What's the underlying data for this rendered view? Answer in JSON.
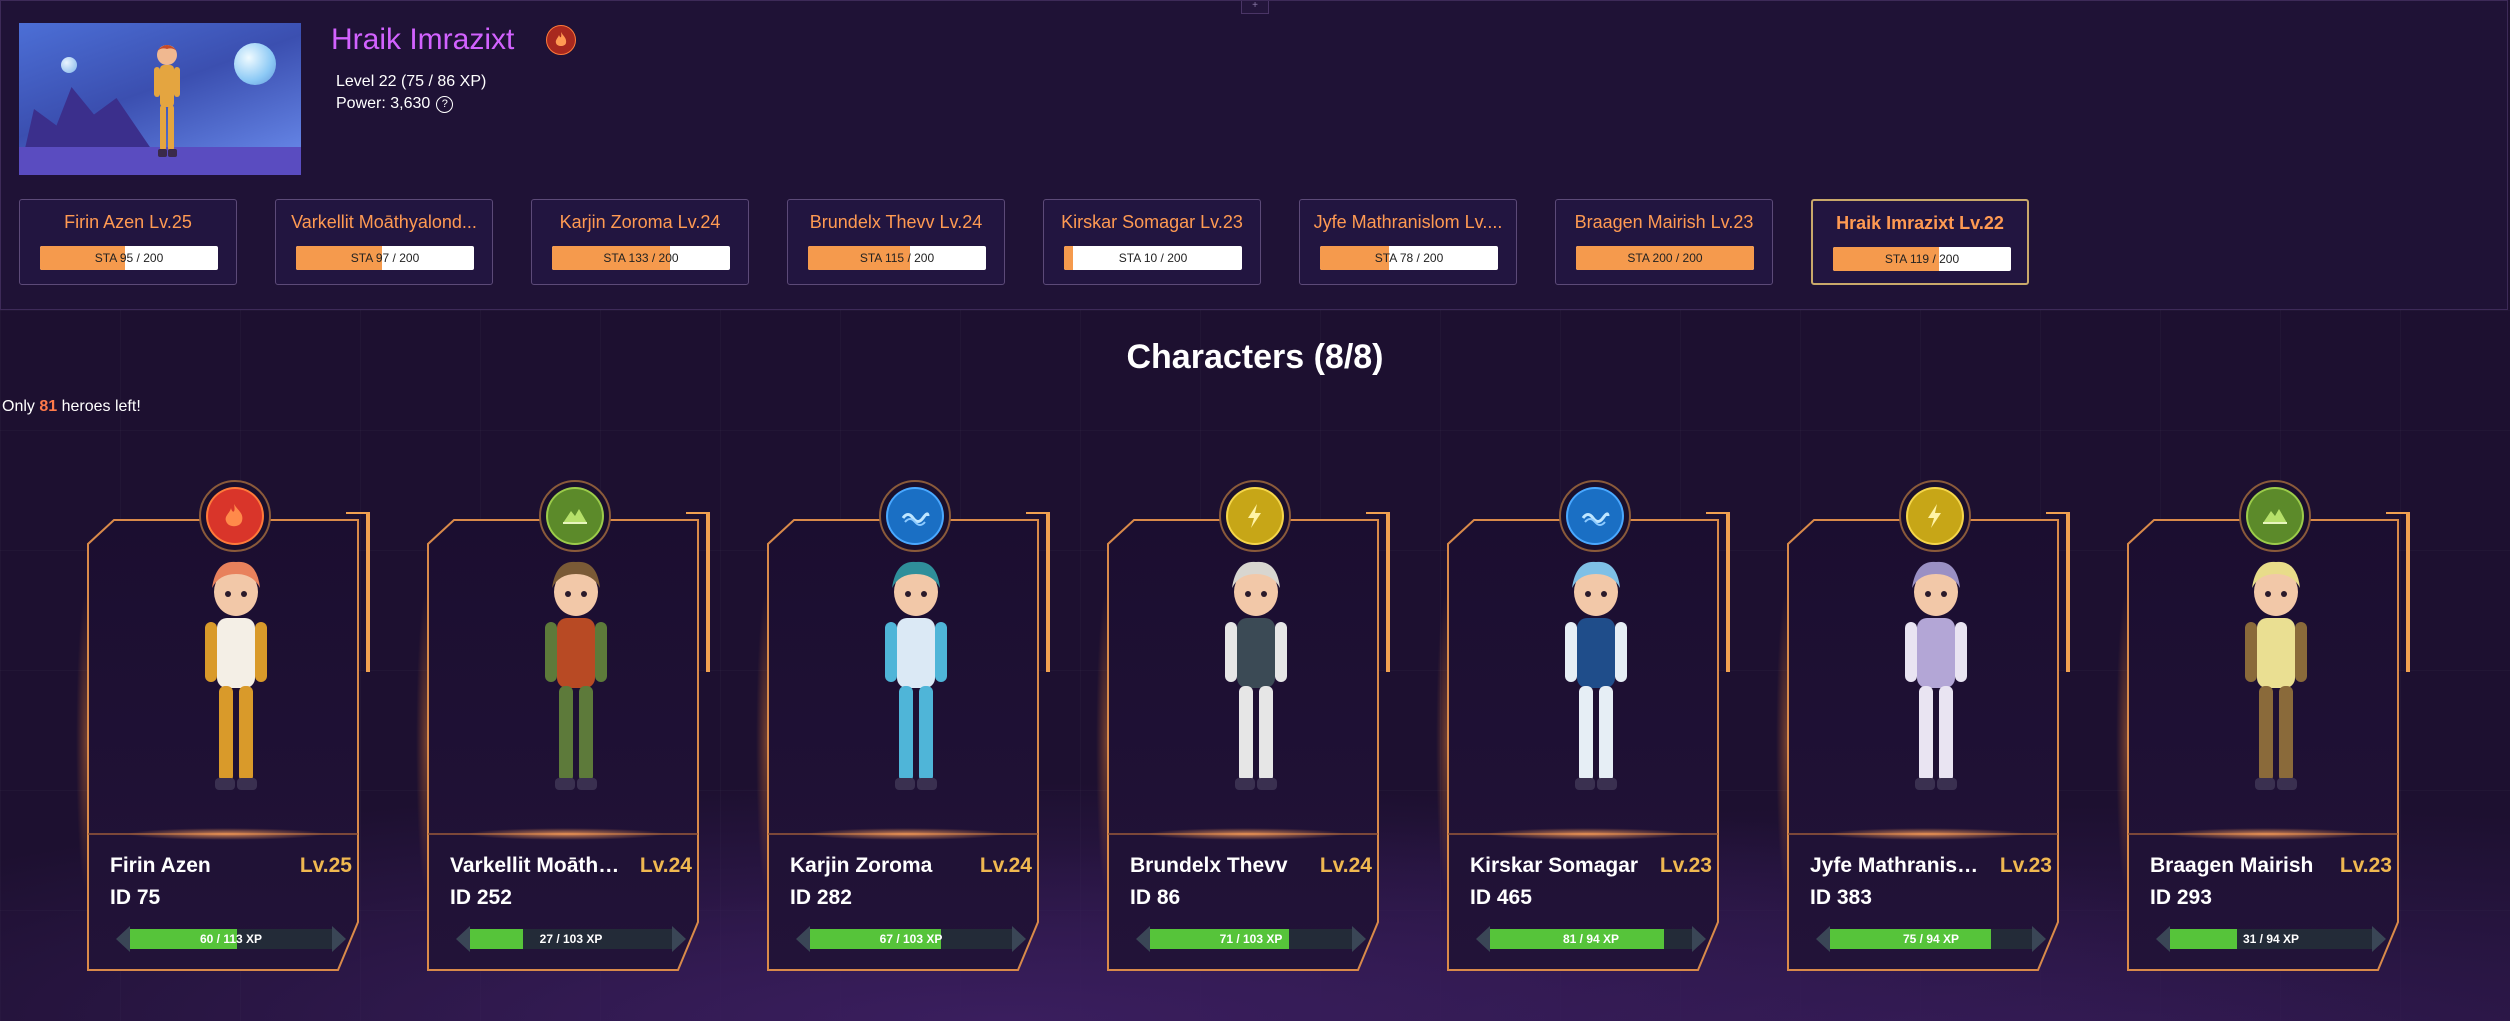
{
  "player": {
    "name": "Hraik Imrazixt",
    "element": "fire",
    "level_text": "Level 22 (75 / 86 XP)",
    "power_text": "Power: 3,630",
    "help_glyph": "?"
  },
  "top_handle_glyph": "+",
  "roster": [
    {
      "name": "Firin Azen Lv.25",
      "sta_text": "STA 95 / 200",
      "sta": 95,
      "sta_max": 200,
      "active": false
    },
    {
      "name": "Varkellit Moāthyalond...",
      "sta_text": "STA 97 / 200",
      "sta": 97,
      "sta_max": 200,
      "active": false
    },
    {
      "name": "Karjin Zoroma Lv.24",
      "sta_text": "STA 133 / 200",
      "sta": 133,
      "sta_max": 200,
      "active": false
    },
    {
      "name": "Brundelx Thevv Lv.24",
      "sta_text": "STA 115 / 200",
      "sta": 115,
      "sta_max": 200,
      "active": false
    },
    {
      "name": "Kirskar Somagar Lv.23",
      "sta_text": "STA 10 / 200",
      "sta": 10,
      "sta_max": 200,
      "active": false
    },
    {
      "name": "Jyfe Mathranislom Lv....",
      "sta_text": "STA 78 / 200",
      "sta": 78,
      "sta_max": 200,
      "active": false
    },
    {
      "name": "Braagen Mairish Lv.23",
      "sta_text": "STA 200 / 200",
      "sta": 200,
      "sta_max": 200,
      "active": false
    },
    {
      "name": "Hraik Imrazixt Lv.22",
      "sta_text": "STA 119 / 200",
      "sta": 119,
      "sta_max": 200,
      "active": true
    }
  ],
  "section": {
    "title": "Characters (8/8)",
    "heroes_left_prefix": "Only",
    "heroes_left_count": "81",
    "heroes_left_suffix": "heroes left!"
  },
  "elements": {
    "fire": {
      "color": "#d9352a",
      "ring": "#ff7a3a",
      "icon": "fire-icon"
    },
    "earth": {
      "color": "#5c8a2a",
      "ring": "#9ccc4a",
      "icon": "mountain-icon"
    },
    "water": {
      "color": "#1a6fc4",
      "ring": "#4aa8ff",
      "icon": "wave-icon"
    },
    "lightning": {
      "color": "#c7a617",
      "ring": "#f5d64a",
      "icon": "lightning-icon"
    }
  },
  "characters": [
    {
      "name": "Firin Azen",
      "level": "Lv.25",
      "id": "ID 75",
      "xp_text": "60 / 113 XP",
      "xp": 60,
      "xp_max": 113,
      "element": "fire",
      "hair": "#e8815c",
      "body": "#f4efe6",
      "accent": "#d99a2a"
    },
    {
      "name": "Varkellit Moāthy...",
      "level": "Lv.24",
      "id": "ID 252",
      "xp_text": "27 / 103 XP",
      "xp": 27,
      "xp_max": 103,
      "element": "earth",
      "hair": "#7a5a36",
      "body": "#b84a24",
      "accent": "#5d7a3a"
    },
    {
      "name": "Karjin Zoroma",
      "level": "Lv.24",
      "id": "ID 282",
      "xp_text": "67 / 103 XP",
      "xp": 67,
      "xp_max": 103,
      "element": "water",
      "hair": "#2f8f9a",
      "body": "#dbe9f5",
      "accent": "#4fb5d8"
    },
    {
      "name": "Brundelx Thevv",
      "level": "Lv.24",
      "id": "ID 86",
      "xp_text": "71 / 103 XP",
      "xp": 71,
      "xp_max": 103,
      "element": "lightning",
      "hair": "#d8d6d0",
      "body": "#3b4a55",
      "accent": "#e6e6e6"
    },
    {
      "name": "Kirskar Somagar",
      "level": "Lv.23",
      "id": "ID 465",
      "xp_text": "81 / 94 XP",
      "xp": 81,
      "xp_max": 94,
      "element": "water",
      "hair": "#7fc0e6",
      "body": "#1f4d8a",
      "accent": "#e6eef5"
    },
    {
      "name": "Jyfe Mathranisl...",
      "level": "Lv.23",
      "id": "ID 383",
      "xp_text": "75 / 94 XP",
      "xp": 75,
      "xp_max": 94,
      "element": "lightning",
      "hair": "#9a90c4",
      "body": "#b3a6d6",
      "accent": "#e9e4f2"
    },
    {
      "name": "Braagen Mairish",
      "level": "Lv.23",
      "id": "ID 293",
      "xp_text": "31 / 94 XP",
      "xp": 31,
      "xp_max": 94,
      "element": "earth",
      "hair": "#e8dc8a",
      "body": "#eadf92",
      "accent": "#8a6a3a"
    }
  ]
}
